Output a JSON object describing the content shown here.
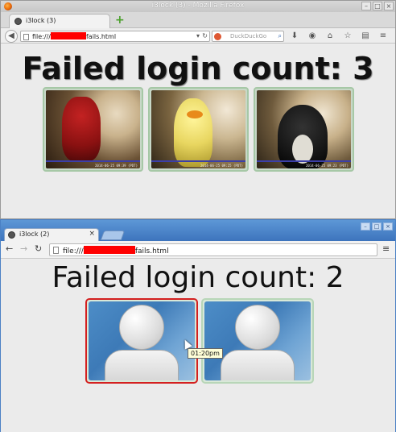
{
  "firefox": {
    "window_title": "i3lock (3) - Mozilla Firefox",
    "tab_label": "i3lock (3)",
    "url_prefix": "file:///",
    "url_suffix": "fails.html",
    "search_placeholder": "DuckDuckGo",
    "heading": "Failed login count: 3",
    "photos": [
      {
        "timestamp": "2014-06-25 09:39 (PDT)"
      },
      {
        "timestamp": "2014-06-25 09:25 (PDT)"
      },
      {
        "timestamp": "2014-06-25 09:23 (PDT)"
      }
    ]
  },
  "chromium": {
    "tab_label": "i3lock (2)",
    "url_prefix": "file:///",
    "url_suffix": "fails.html",
    "heading": "Failed login count: 2",
    "tooltip": "01:20pm"
  },
  "colors": {
    "redaction": "#ff0000",
    "selected_border": "#d42020",
    "card_border": "#b8d6b8",
    "titlebar_blue": "#4a80c4"
  }
}
